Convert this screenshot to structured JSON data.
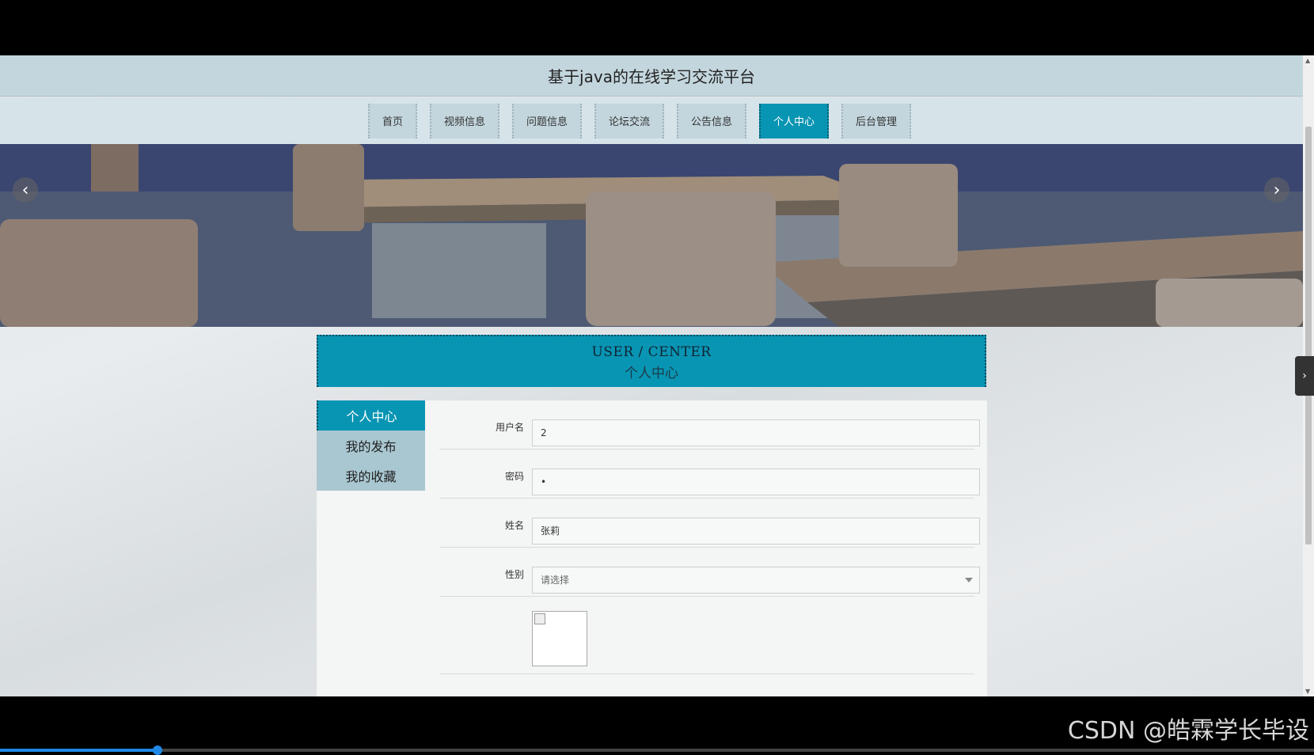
{
  "app": {
    "title": "基于java的在线学习交流平台"
  },
  "nav": {
    "items": [
      {
        "label": "首页",
        "active": false
      },
      {
        "label": "视频信息",
        "active": false
      },
      {
        "label": "问题信息",
        "active": false
      },
      {
        "label": "论坛交流",
        "active": false
      },
      {
        "label": "公告信息",
        "active": false
      },
      {
        "label": "个人中心",
        "active": true
      },
      {
        "label": "后台管理",
        "active": false
      }
    ]
  },
  "banner": {
    "prev_icon": "chevron-left-icon",
    "next_icon": "chevron-right-icon"
  },
  "section": {
    "title_en": "USER / CENTER",
    "title_zh": "个人中心"
  },
  "sidebar": {
    "items": [
      {
        "label": "个人中心",
        "active": true
      },
      {
        "label": "我的发布",
        "active": false
      },
      {
        "label": "我的收藏",
        "active": false
      }
    ]
  },
  "form": {
    "username": {
      "label": "用户名",
      "value": "2"
    },
    "password": {
      "label": "密码",
      "value": "•"
    },
    "name": {
      "label": "姓名",
      "value": "张莉"
    },
    "gender": {
      "label": "性别",
      "value": "请选择"
    }
  },
  "video": {
    "progress_fraction": 0.12
  },
  "watermark": {
    "text": "CSDN @皓霖学长毕设"
  },
  "colors": {
    "accent": "#0895b3",
    "header_bg": "#c3d6dd",
    "nav_bg": "#d6e3e8"
  }
}
